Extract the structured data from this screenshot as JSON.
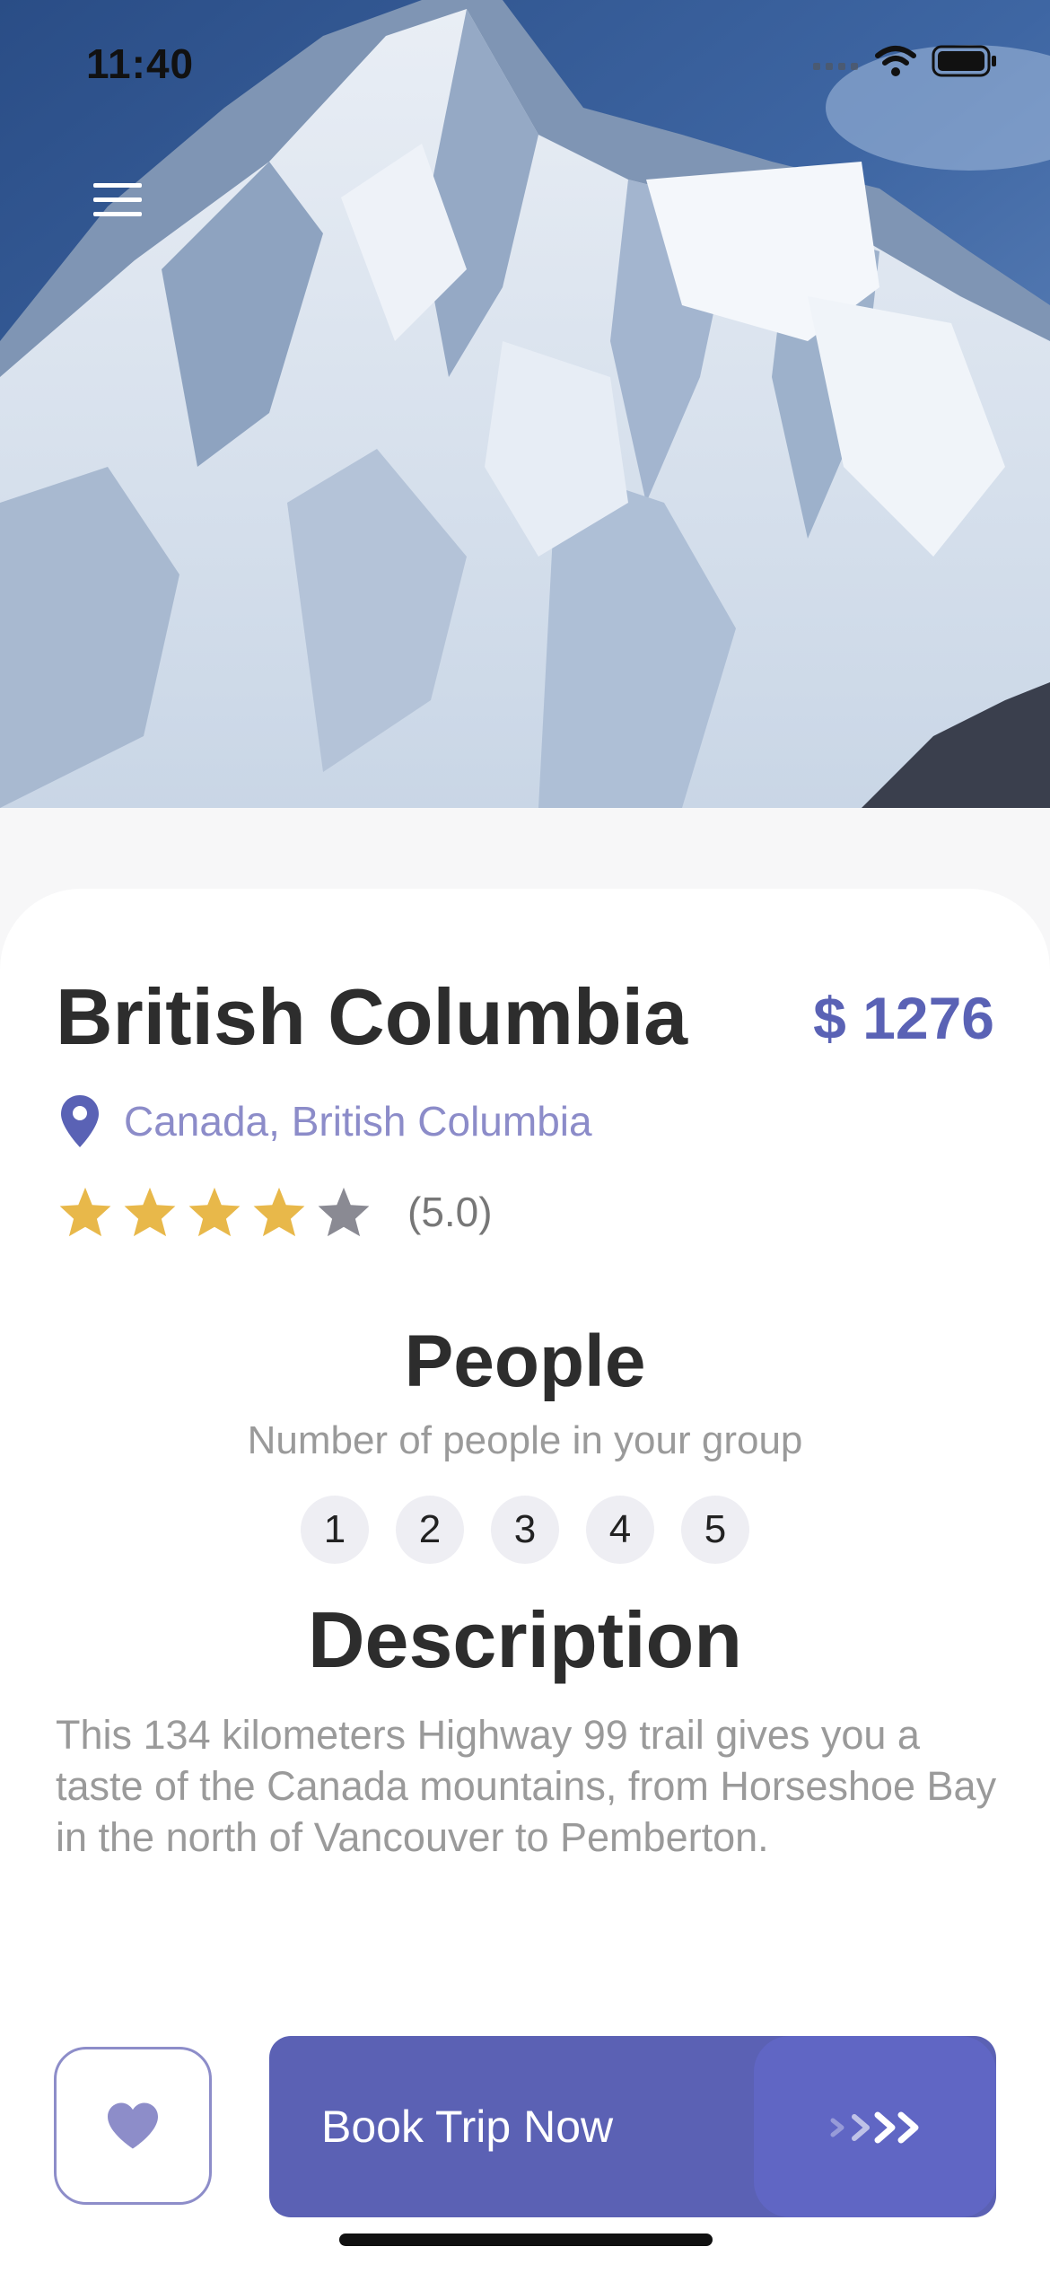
{
  "status_bar": {
    "time": "11:40"
  },
  "header": {
    "menu_icon": "hamburger-menu-icon"
  },
  "destination": {
    "title": "British Columbia",
    "price": "$ 1276",
    "location": "Canada, British Columbia",
    "location_icon": "map-pin-icon",
    "rating_text": "(5.0)",
    "stars_filled": 4,
    "stars_total": 5
  },
  "people": {
    "heading": "People",
    "subtitle": "Number of people in your group",
    "options": [
      "1",
      "2",
      "3",
      "4",
      "5"
    ]
  },
  "description": {
    "heading": "Description",
    "text": "This 134 kilometers Highway 99 trail gives you a taste of the Canada mountains, from Horseshoe Bay in the north of Vancouver to Pemberton."
  },
  "actions": {
    "favorite_icon": "heart-icon",
    "book_label": "Book Trip Now",
    "book_icon": "triple-chevron-right-icon"
  },
  "colors": {
    "accent": "#5a62b5",
    "accent_light": "#8c8cc9",
    "star_filled": "#e8b84a",
    "star_empty": "#8a8a93"
  }
}
